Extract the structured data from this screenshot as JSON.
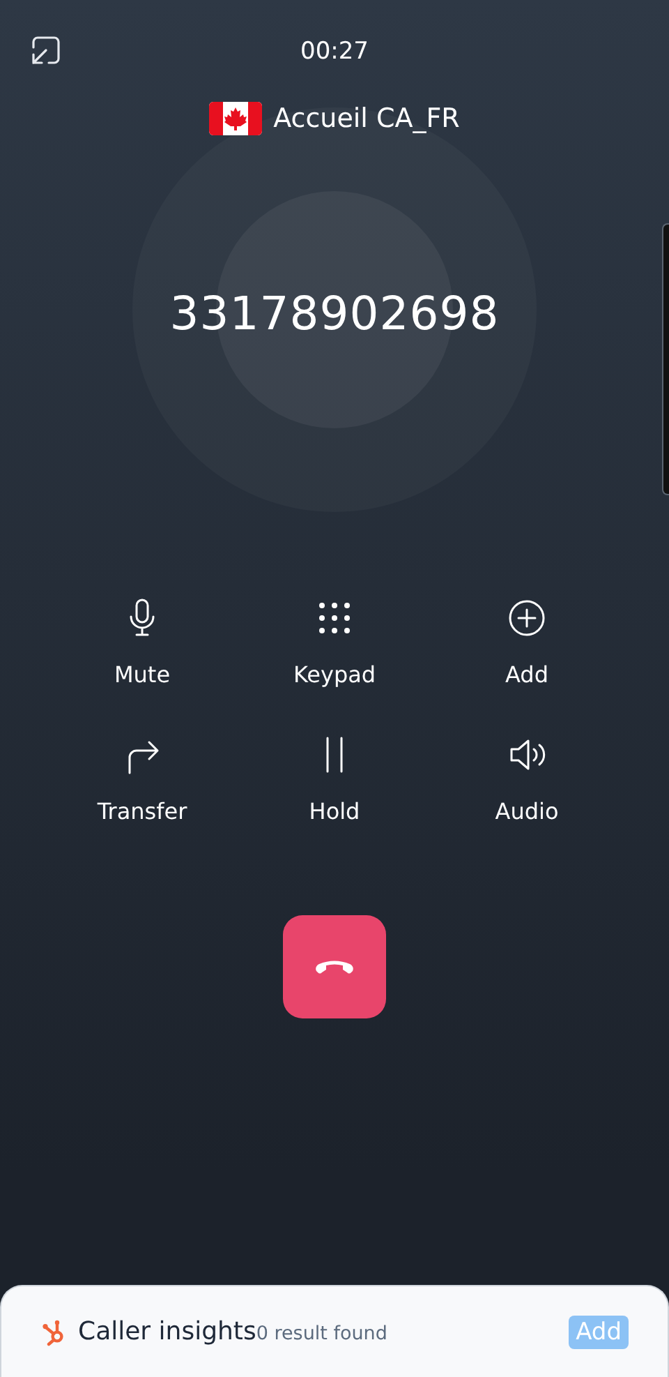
{
  "timer": "00:27",
  "line": {
    "name": "Accueil CA_FR"
  },
  "number": "33178902698",
  "controls": [
    {
      "kind": "mute",
      "label": "Mute"
    },
    {
      "kind": "keypad",
      "label": "Keypad"
    },
    {
      "kind": "add",
      "label": "Add"
    },
    {
      "kind": "transfer",
      "label": "Transfer"
    },
    {
      "kind": "hold",
      "label": "Hold"
    },
    {
      "kind": "audio",
      "label": "Audio"
    }
  ],
  "insights": {
    "title": "Caller insights",
    "result": "0 result found",
    "button": "Add"
  }
}
